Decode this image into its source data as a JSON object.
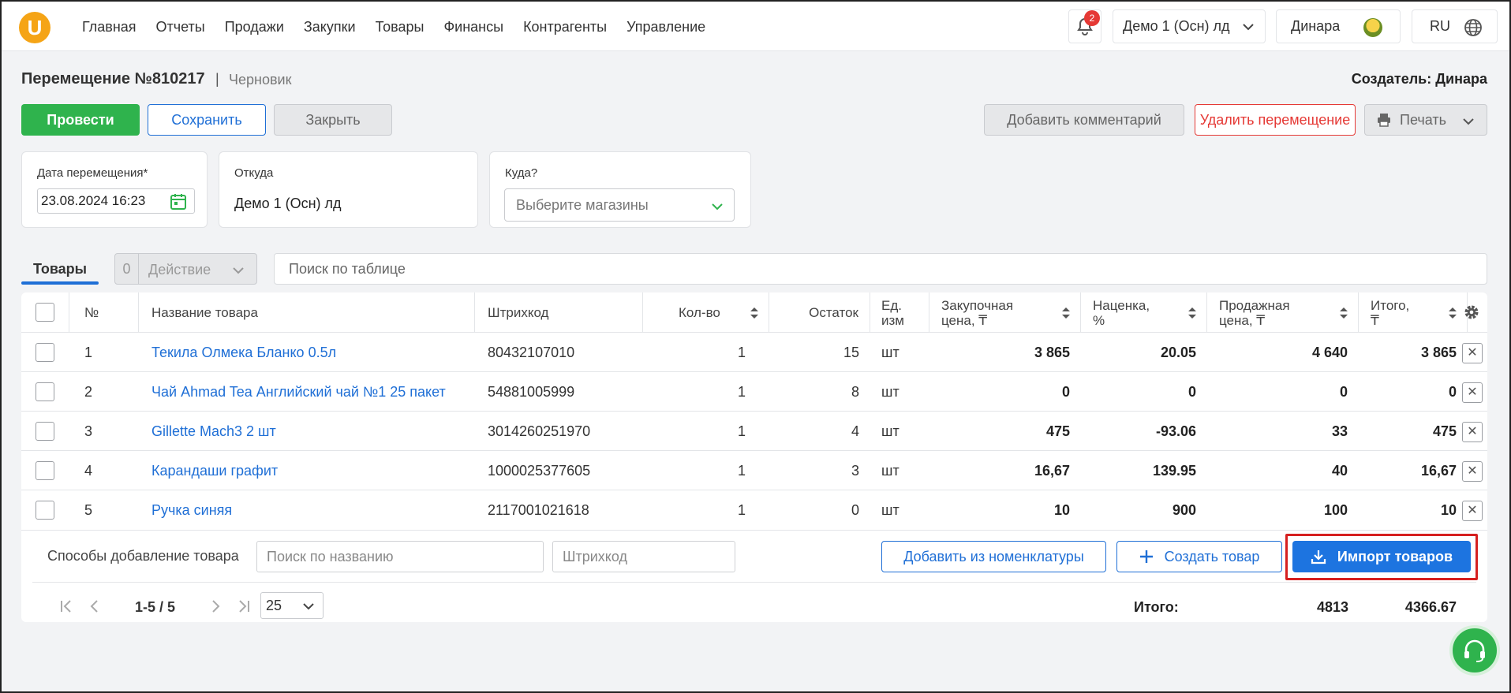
{
  "header": {
    "logo_letter": "U",
    "nav": [
      "Главная",
      "Отчеты",
      "Продажи",
      "Закупки",
      "Товары",
      "Финансы",
      "Контрагенты",
      "Управление"
    ],
    "notifications_count": "2",
    "store": "Демо 1 (Осн) лд",
    "user": "Динара",
    "lang": "RU"
  },
  "doc": {
    "title": "Перемещение №810217",
    "separator": "|",
    "status": "Черновик",
    "creator": "Создатель: Динара"
  },
  "actions": {
    "conduct": "Провести",
    "save": "Сохранить",
    "close": "Закрыть",
    "comment": "Добавить комментарий",
    "delete": "Удалить перемещение",
    "print": "Печать"
  },
  "fields": {
    "date_label": "Дата перемещения*",
    "date_value": "23.08.2024 16:23",
    "from_label": "Откуда",
    "from_value": "Демо 1 (Осн) лд",
    "to_label": "Куда?",
    "to_placeholder": "Выберите магазины"
  },
  "tabs": {
    "products": "Товары",
    "action_count": "0",
    "action_label": "Действие",
    "search_placeholder": "Поиск по таблице"
  },
  "table": {
    "columns": {
      "num": "№",
      "name": "Название товара",
      "barcode": "Штрихкод",
      "qty": "Кол-во",
      "stock": "Остаток",
      "unit_1": "Ед.",
      "unit_2": "изм",
      "purchase_1": "Закупочная",
      "purchase_2": "цена, ₸",
      "markup_1": "Наценка,",
      "markup_2": "%",
      "sale_1": "Продажная",
      "sale_2": "цена, ₸",
      "total_1": "Итого,",
      "total_2": "₸"
    },
    "rows": [
      {
        "num": "1",
        "name": "Текила Олмека Бланко 0.5л",
        "barcode": "80432107010",
        "qty": "1",
        "stock": "15",
        "unit": "шт",
        "purchase": "3 865",
        "markup": "20.05",
        "sale": "4 640",
        "total": "3 865"
      },
      {
        "num": "2",
        "name": "Чай Ahmad Tea Английский чай №1 25 пакет",
        "barcode": "54881005999",
        "qty": "1",
        "stock": "8",
        "unit": "шт",
        "purchase": "0",
        "markup": "0",
        "sale": "0",
        "total": "0"
      },
      {
        "num": "3",
        "name": "Gillette Mach3 2 шт",
        "barcode": "3014260251970",
        "qty": "1",
        "stock": "4",
        "unit": "шт",
        "purchase": "475",
        "markup": "-93.06",
        "sale": "33",
        "total": "475"
      },
      {
        "num": "4",
        "name": "Карандаши графит",
        "barcode": "1000025377605",
        "qty": "1",
        "stock": "3",
        "unit": "шт",
        "purchase": "16,67",
        "markup": "139.95",
        "sale": "40",
        "total": "16,67"
      },
      {
        "num": "5",
        "name": "Ручка синяя",
        "barcode": "2117001021618",
        "qty": "1",
        "stock": "0",
        "unit": "шт",
        "purchase": "10",
        "markup": "900",
        "sale": "100",
        "total": "10"
      }
    ]
  },
  "add": {
    "label": "Способы добавление товара",
    "name_placeholder": "Поиск по названию",
    "barcode_placeholder": "Штрихкод",
    "from_nomenclature": "Добавить из номенклатуры",
    "create": "Создать товар",
    "import": "Импорт товаров"
  },
  "pager": {
    "range": "1-5 / 5",
    "page_size": "25",
    "total_label": "Итого:",
    "total_sale": "4813",
    "total_sum": "4366.67"
  },
  "colors": {
    "accent": "#1f6fd6",
    "green": "#2fb34d",
    "danger": "#e53935",
    "highlight": "#d62020"
  }
}
